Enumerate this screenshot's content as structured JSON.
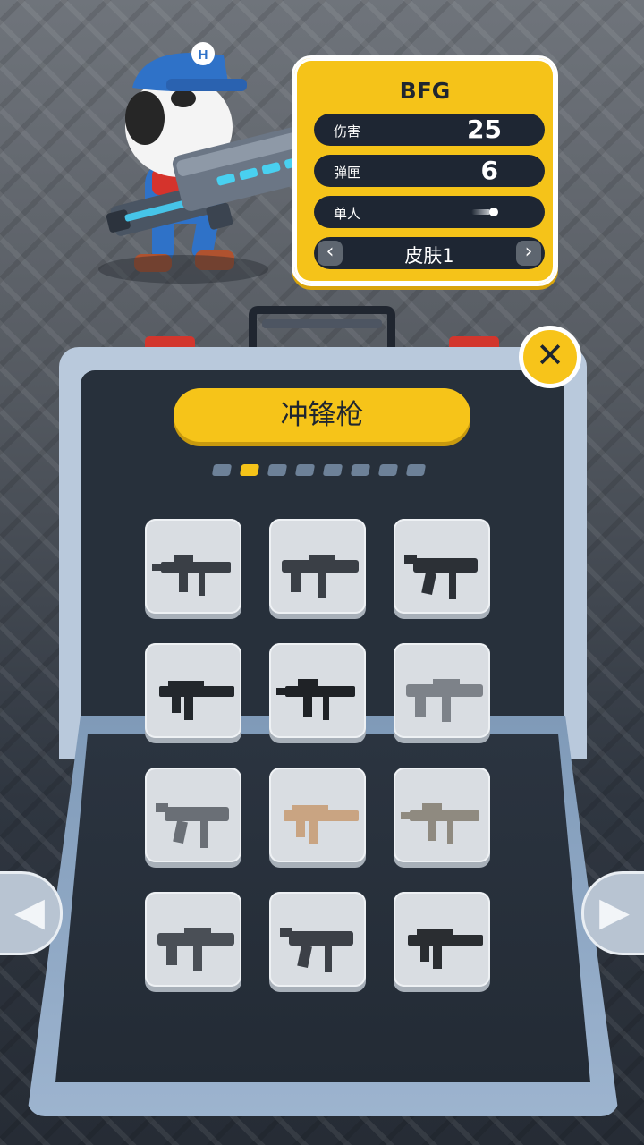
{
  "stats": {
    "weapon_name": "BFG",
    "damage_label": "伤害",
    "damage_value": "25",
    "ammo_label": "弹匣",
    "ammo_value": "6",
    "fire_mode_label": "单人",
    "skin_label": "皮肤1",
    "skin_prev_icon": "chevron-left-icon",
    "skin_next_icon": "chevron-right-icon"
  },
  "panel": {
    "category_title": "冲锋枪",
    "page_count": 8,
    "active_page": 2,
    "close_icon": "close-icon"
  },
  "weapons": [
    {
      "name": "smg-1",
      "color": "#3a3f46"
    },
    {
      "name": "smg-2",
      "color": "#3a3f46"
    },
    {
      "name": "smg-3",
      "color": "#2c3036"
    },
    {
      "name": "smg-4",
      "color": "#23272c"
    },
    {
      "name": "smg-5",
      "color": "#1f2226"
    },
    {
      "name": "smg-6",
      "color": "#7d8289"
    },
    {
      "name": "smg-7",
      "color": "#6a6f76"
    },
    {
      "name": "smg-8",
      "color": "#c9a482"
    },
    {
      "name": "smg-9",
      "color": "#8f8a80"
    },
    {
      "name": "smg-10",
      "color": "#4a4f56"
    },
    {
      "name": "smg-11",
      "color": "#3c4047"
    },
    {
      "name": "smg-12",
      "color": "#2a2d31"
    }
  ],
  "colors": {
    "accent": "#f5c319",
    "dark": "#1e2633",
    "close_red": "#d2362d"
  }
}
